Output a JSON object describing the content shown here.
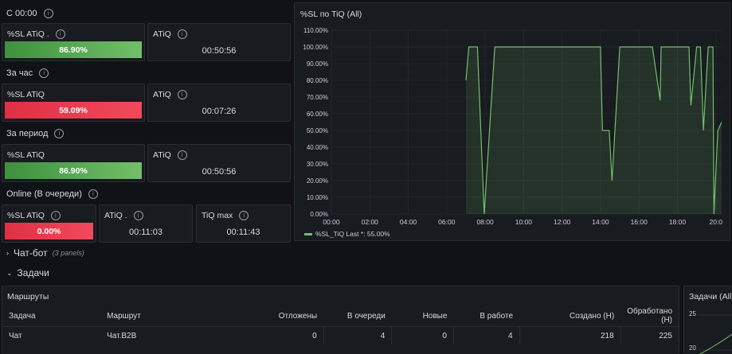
{
  "groups": [
    {
      "label": "С 00:00",
      "sl_label": "%SL ATiQ .",
      "sl_value": "86.90%",
      "atiq_label": "ATiQ",
      "atiq_value": "00:50:56"
    },
    {
      "label": "За час",
      "sl_label": "%SL ATiQ",
      "sl_value": "59.09%",
      "atiq_label": "ATiQ",
      "atiq_value": "00:07:26"
    },
    {
      "label": "За период",
      "sl_label": "%SL ATiQ",
      "sl_value": "86.90%",
      "atiq_label": "ATiQ",
      "atiq_value": "00:50:56"
    }
  ],
  "online": {
    "label": "Online (В очереди)",
    "sl_label": "%SL ATiQ",
    "sl_value": "0.00%",
    "atiq_label": "ATiQ .",
    "atiq_value": "00:11:03",
    "tiqmax_label": "TiQ max",
    "tiqmax_value": "00:11:43"
  },
  "colors": {
    "green": "#73bf69",
    "red": "#f2495c",
    "line": "#73bf69"
  },
  "chart_data": {
    "type": "area",
    "title": "%SL по TiQ (All)",
    "y_ticks": [
      "110.00%",
      "100.00%",
      "90.00%",
      "80.00%",
      "70.00%",
      "60.00%",
      "50.00%",
      "40.00%",
      "30.00%",
      "20.00%",
      "10.00%",
      "0.00%"
    ],
    "x_ticks": [
      "00:00",
      "02:00",
      "04:00",
      "06:00",
      "08:00",
      "10:00",
      "12:00",
      "14:00",
      "16:00",
      "18:00",
      "20:0"
    ],
    "ylim": [
      0,
      110
    ],
    "xlim": [
      0,
      20.3
    ],
    "series": [
      {
        "name": "%SL_TiQ",
        "x": [
          7.0,
          7.15,
          7.6,
          7.95,
          8.5,
          14.0,
          14.1,
          14.45,
          14.6,
          15.0,
          15.1,
          16.7,
          17.1,
          17.15,
          17.6,
          17.7,
          18.6,
          18.7,
          19.0,
          19.2,
          19.35,
          19.6,
          19.85,
          19.9,
          20.1,
          20.3
        ],
        "y": [
          80,
          100,
          100,
          0,
          100,
          100,
          50,
          50,
          20,
          100,
          100,
          100,
          68,
          100,
          100,
          100,
          100,
          65,
          100,
          100,
          50,
          100,
          100,
          0,
          50,
          55
        ]
      }
    ],
    "legend": {
      "name": "%SL_TiQ",
      "text": "Last *: 55.00%"
    }
  },
  "chatbot": {
    "label": "Чат-бот",
    "count": "(3 panels)"
  },
  "tasks": {
    "label": "Задачи"
  },
  "routes": {
    "title": "Маршруты",
    "columns": [
      "Задача",
      "Маршрут",
      "Отложены",
      "В очереди",
      "Новые",
      "В работе",
      "Создано (Н)",
      "Обработано (Н)"
    ],
    "rows": [
      [
        "Чат",
        "Чат.B2B",
        "0",
        "4",
        "0",
        "4",
        "218",
        "225"
      ]
    ]
  },
  "mini_panel": {
    "title": "Задачи (All)",
    "ticks": [
      "25",
      "20"
    ]
  }
}
